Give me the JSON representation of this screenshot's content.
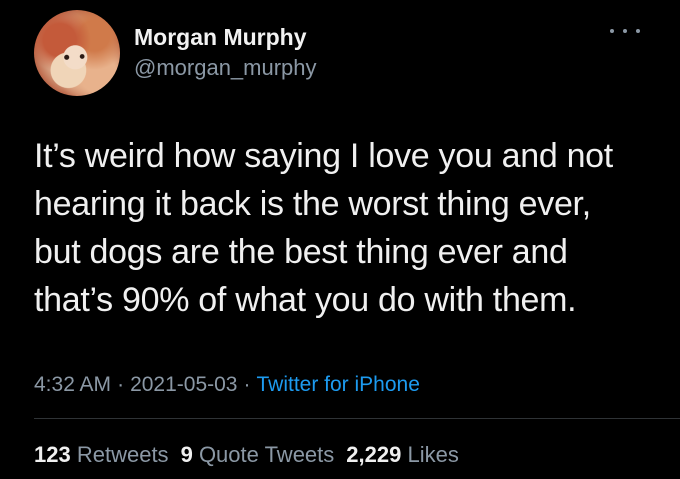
{
  "author": {
    "display_name": "Morgan Murphy",
    "handle": "@morgan_murphy",
    "avatar": "profile-photo-dog"
  },
  "more_menu_icon": "ellipsis-icon",
  "tweet": {
    "lines": [
      "It’s weird how saying I love you and not",
      "hearing it back is the worst thing ever,",
      "but dogs are the best thing ever and",
      "that’s 90% of what you do with them."
    ]
  },
  "meta": {
    "time": "4:32 AM",
    "separator": "·",
    "date": "2021-05-03",
    "source": "Twitter for iPhone"
  },
  "stats": {
    "retweets": {
      "count": "123",
      "label": "Retweets"
    },
    "quote_tweets": {
      "count": "9",
      "label": "Quote Tweets"
    },
    "likes": {
      "count": "2,229",
      "label": "Likes"
    }
  },
  "colors": {
    "background": "#000000",
    "text": "#e7e9ea",
    "secondary": "#8b98a5",
    "link": "#1d9bf0"
  }
}
